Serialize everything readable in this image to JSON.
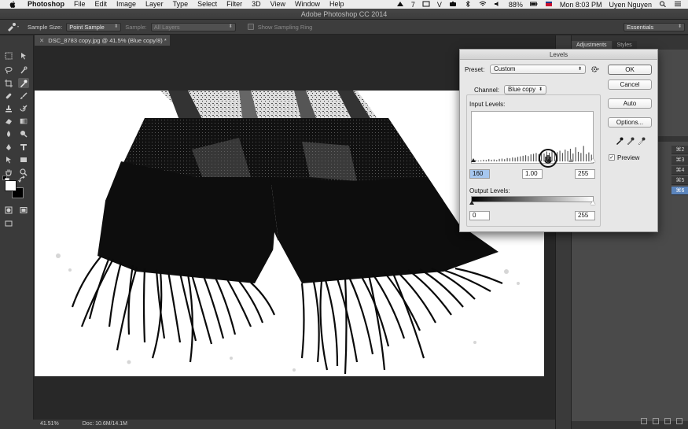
{
  "menubar": {
    "app": "Photoshop",
    "items": [
      "File",
      "Edit",
      "Image",
      "Layer",
      "Type",
      "Select",
      "Filter",
      "3D",
      "View",
      "Window",
      "Help"
    ],
    "battery": "88%",
    "clock": "Mon 8:03 PM",
    "user": "Uyen Nguyen",
    "status_a": "7",
    "status_v": "V"
  },
  "window": {
    "title": "Adobe Photoshop CC 2014"
  },
  "options": {
    "sample_size_label": "Sample Size:",
    "sample_size_value": "Point Sample",
    "sample_label": "Sample:",
    "sample_value": "All Layers",
    "sampling_ring_label": "Show Sampling Ring",
    "workspace": "Essentials"
  },
  "document": {
    "tab_title": "DSC_8783 copy.jpg @ 41.5% (Blue copy/8) *"
  },
  "status": {
    "zoom": "41.51%",
    "doc_size": "Doc: 10.6M/14.1M"
  },
  "panels": {
    "tab_adjustments": "Adjustments",
    "tab_styles": "Styles",
    "channel_shortcuts": [
      "⌘2",
      "⌘3",
      "⌘4",
      "⌘5",
      "⌘6"
    ]
  },
  "levels": {
    "title": "Levels",
    "preset_label": "Preset:",
    "preset_value": "Custom",
    "channel_label": "Channel:",
    "channel_value": "Blue copy",
    "input_levels_label": "Input Levels:",
    "input_black": "160",
    "input_gamma": "1.00",
    "input_white": "255",
    "output_levels_label": "Output Levels:",
    "output_black": "0",
    "output_white": "255",
    "btn_ok": "OK",
    "btn_cancel": "Cancel",
    "btn_auto": "Auto",
    "btn_options": "Options...",
    "preview_label": "Preview",
    "preview_checked": true,
    "histogram_levels": [
      0.02,
      0.05,
      0.03,
      0.04,
      0.06,
      0.05,
      0.08,
      0.06,
      0.07,
      0.05,
      0.09,
      0.1,
      0.08,
      0.12,
      0.11,
      0.14,
      0.13,
      0.16,
      0.18,
      0.2,
      0.22,
      0.19,
      0.25,
      0.27,
      0.3,
      0.26,
      0.33,
      0.28,
      0.35,
      0.31,
      0.4,
      0.36,
      0.33,
      0.38,
      0.3,
      0.42,
      0.37,
      0.45,
      0.28,
      0.5,
      0.34,
      0.3,
      0.55,
      0.26,
      0.32,
      0.24
    ]
  }
}
